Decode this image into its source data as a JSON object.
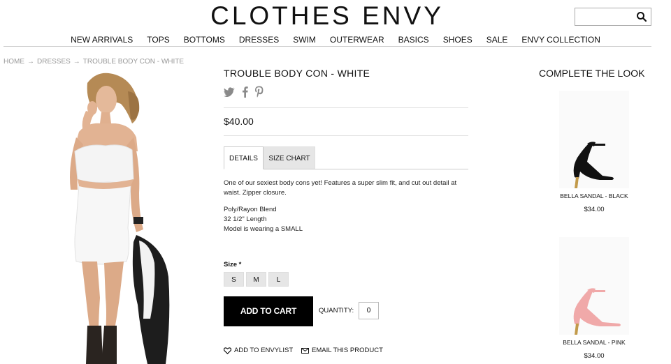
{
  "header": {
    "logo": "CLOTHES ENVY",
    "search": {
      "placeholder": ""
    }
  },
  "nav": {
    "items": [
      "NEW ARRIVALS",
      "TOPS",
      "BOTTOMS",
      "DRESSES",
      "SWIM",
      "OUTERWEAR",
      "BASICS",
      "SHOES",
      "SALE",
      "ENVY COLLECTION"
    ]
  },
  "breadcrumb": {
    "home": "HOME",
    "sep": "→",
    "category": "DRESSES",
    "current": "TROUBLE BODY CON - WHITE"
  },
  "product": {
    "title": "TROUBLE BODY CON - WHITE",
    "price": "$40.00",
    "tabs": {
      "details": "DETAILS",
      "size_chart": "SIZE CHART"
    },
    "description": "One of our sexiest body cons yet! Features a super slim fit, and cut out detail at waist. Zipper closure.",
    "specs": [
      "Poly/Rayon Blend",
      "32 1/2\" Length",
      "Model is wearing a SMALL"
    ],
    "size_label": "Size *",
    "sizes": [
      "S",
      "M",
      "L"
    ],
    "add_to_cart": "ADD TO CART",
    "quantity_label": "QUANTITY:",
    "quantity_value": "0",
    "add_to_envylist": "ADD TO ENVYLIST",
    "email_product": "EMAIL THIS PRODUCT"
  },
  "complete_the_look": {
    "title": "COMPLETE THE LOOK",
    "items": [
      {
        "name": "BELLA SANDAL - BLACK",
        "price": "$34.00",
        "color": "#111111"
      },
      {
        "name": "BELLA SANDAL - PINK",
        "price": "$34.00",
        "color": "#f0a9a9"
      }
    ]
  }
}
